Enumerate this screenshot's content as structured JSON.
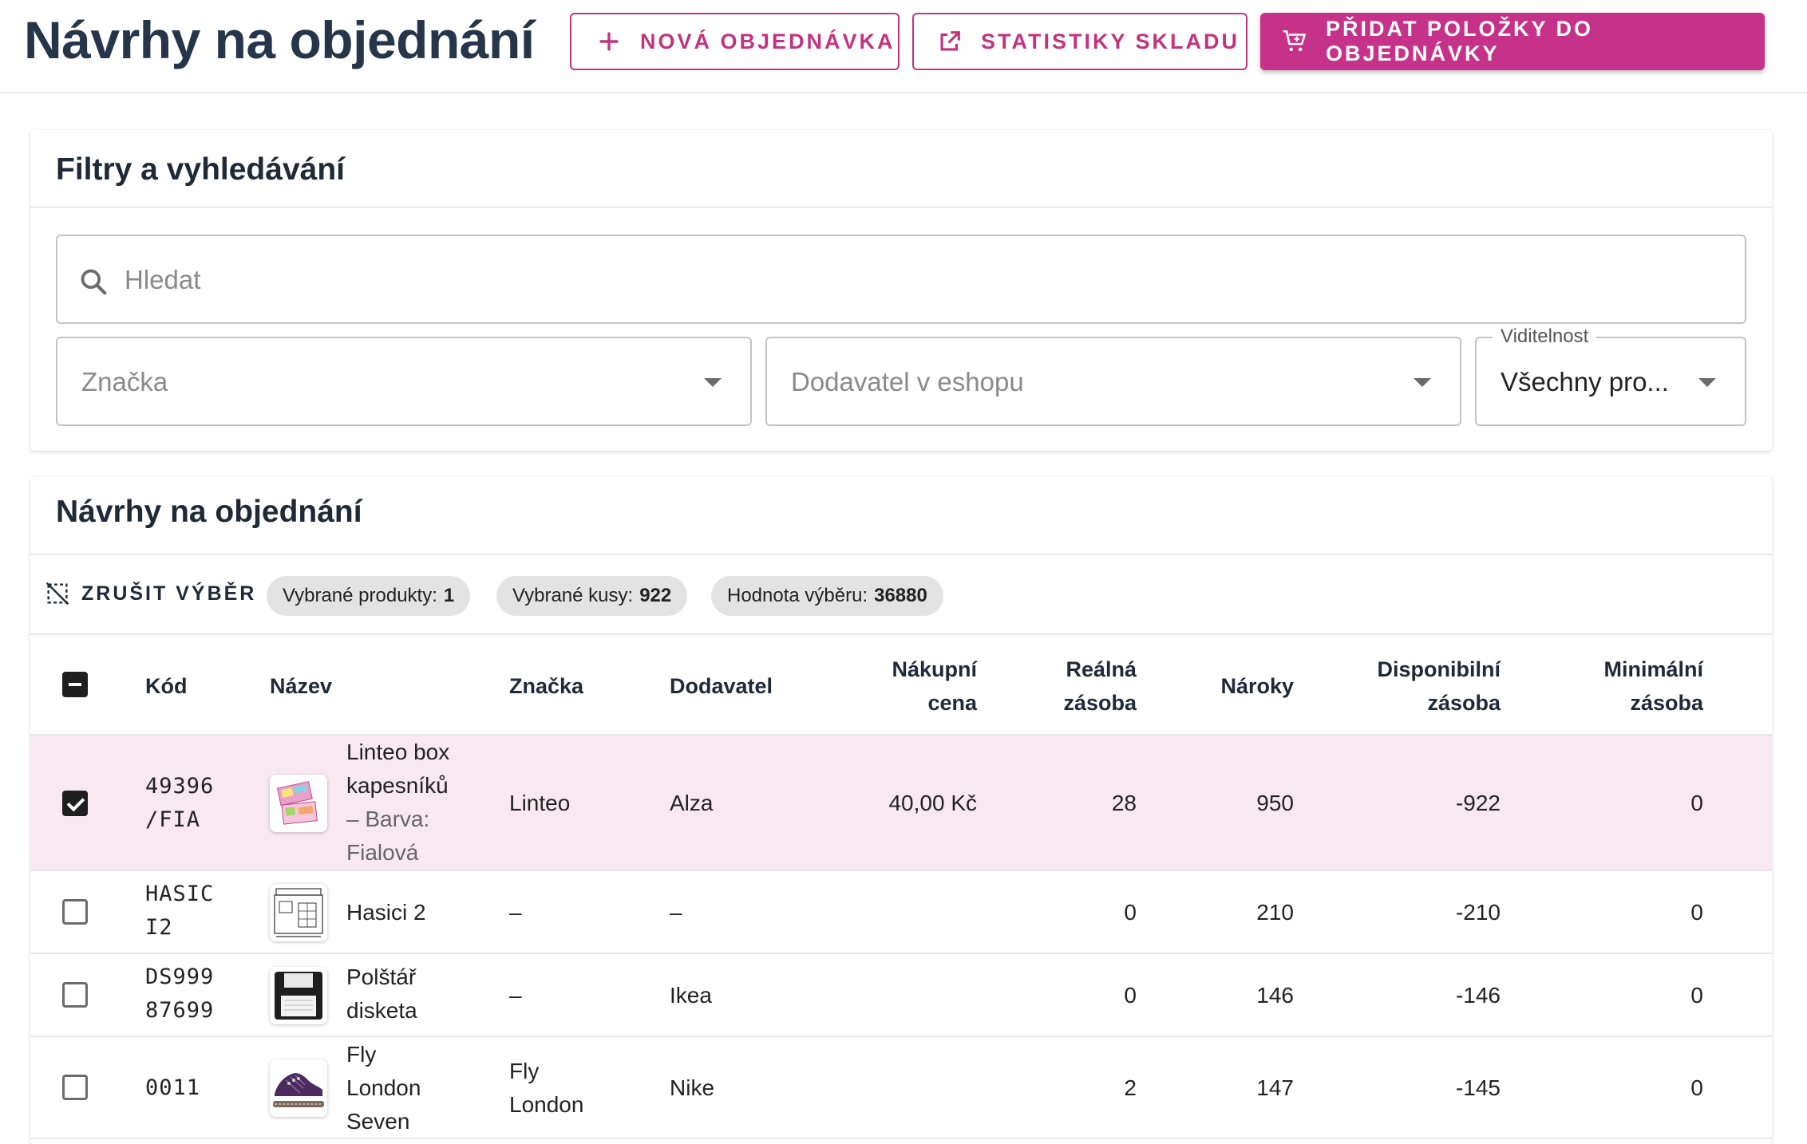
{
  "header": {
    "title": "Návrhy na objednání",
    "buttons": {
      "new_order": "Nová objednávka",
      "stock_stats": "Statistiky skladu",
      "add_to_order": "Přidat položky do objednávky"
    }
  },
  "filters": {
    "title": "Filtry a vyhledávání",
    "search_placeholder": "Hledat",
    "brand_placeholder": "Značka",
    "supplier_placeholder": "Dodavatel v eshopu",
    "visibility_label": "Viditelnost",
    "visibility_value": "Všechny pro..."
  },
  "suggestions": {
    "title": "Návrhy na objednání",
    "clear_selection": "Zrušit výběr",
    "chips": {
      "products_label": "Vybrané produkty:",
      "products_value": "1",
      "pieces_label": "Vybrané kusy:",
      "pieces_value": "922",
      "value_label": "Hodnota výběru:",
      "value_value": "36880"
    },
    "columns": {
      "code": "Kód",
      "name": "Název",
      "brand": "Značka",
      "supplier": "Dodavatel",
      "purchase_price_1": "Nákupní",
      "purchase_price_2": "cena",
      "real_stock_1": "Reálná",
      "real_stock_2": "zásoba",
      "claims": "Nároky",
      "available_1": "Disponibilní",
      "available_2": "zásoba",
      "min_1": "Minimální",
      "min_2": "zásoba"
    },
    "rows": [
      {
        "code_1": "49396",
        "code_2": "/FIA",
        "name_1": "Linteo box",
        "name_2": "kapesníků",
        "variant_1": "– Barva:",
        "variant_2": "Fialová",
        "brand": "Linteo",
        "supplier": "Alza",
        "price": "40,00 Kč",
        "real_stock": "28",
        "claims": "950",
        "available": "-922",
        "min_stock": "0",
        "selected": true,
        "thumb_icon": "tissue-box-thumbnail"
      },
      {
        "code_1": "HASIC",
        "code_2": "I2",
        "name_1": "Hasici 2",
        "brand": "–",
        "supplier": "–",
        "price": "",
        "real_stock": "0",
        "claims": "210",
        "available": "-210",
        "min_stock": "0",
        "selected": false,
        "thumb_icon": "fire-station-thumbnail"
      },
      {
        "code_1": "DS999",
        "code_2": "87699",
        "name_1": "Polštář",
        "name_2": "disketa",
        "brand": "–",
        "supplier": "Ikea",
        "price": "",
        "real_stock": "0",
        "claims": "146",
        "available": "-146",
        "min_stock": "0",
        "selected": false,
        "thumb_icon": "floppy-pillow-thumbnail"
      },
      {
        "code_1": "0011",
        "name_1": "Fly",
        "name_2": "London",
        "name_3": "Seven",
        "brand_1": "Fly",
        "brand_2": "London",
        "supplier": "Nike",
        "price": "",
        "real_stock": "2",
        "claims": "147",
        "available": "-145",
        "min_stock": "0",
        "selected": false,
        "thumb_icon": "shoe-thumbnail"
      }
    ]
  },
  "colors": {
    "accent": "#c6318a",
    "title": "#25354a",
    "selected_row": "#f8e8f2"
  }
}
